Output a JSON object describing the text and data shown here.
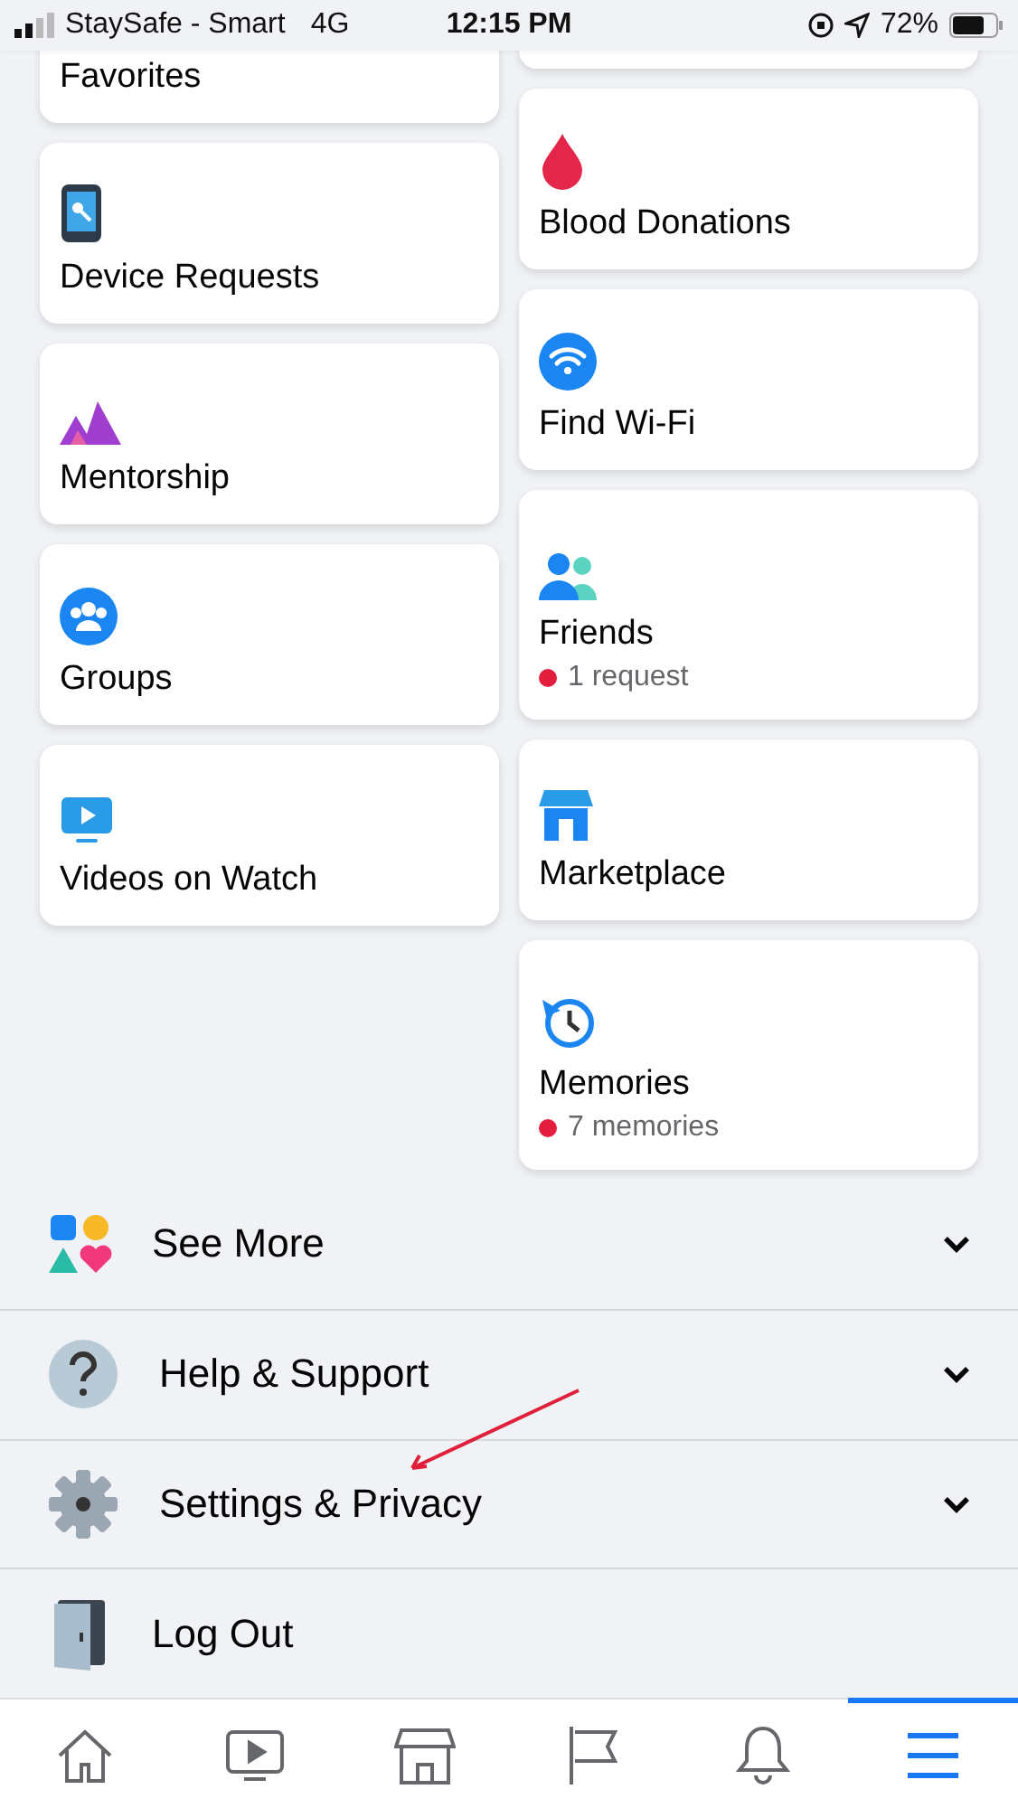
{
  "status_bar": {
    "carrier": "StaySafe - Smart",
    "network": "4G",
    "time": "12:15 PM",
    "battery": "72%"
  },
  "shortcuts_left": [
    {
      "title": "Favorites"
    },
    {
      "title": "Device Requests"
    },
    {
      "title": "Mentorship"
    },
    {
      "title": "Groups"
    },
    {
      "title": "Videos on Watch"
    }
  ],
  "shortcuts_right": [
    {
      "title": "Blood Donations"
    },
    {
      "title": "Find Wi-Fi"
    },
    {
      "title": "Friends",
      "subtitle": "1 request"
    },
    {
      "title": "Marketplace"
    },
    {
      "title": "Memories",
      "subtitle": "7 memories"
    }
  ],
  "menu": [
    {
      "label": "See More",
      "expandable": true
    },
    {
      "label": "Help & Support",
      "expandable": true
    },
    {
      "label": "Settings & Privacy",
      "expandable": true
    },
    {
      "label": "Log Out",
      "expandable": false
    }
  ],
  "tabs": [
    {
      "selected": false
    },
    {
      "selected": false
    },
    {
      "selected": false
    },
    {
      "selected": false
    },
    {
      "selected": false
    },
    {
      "selected": true
    }
  ]
}
